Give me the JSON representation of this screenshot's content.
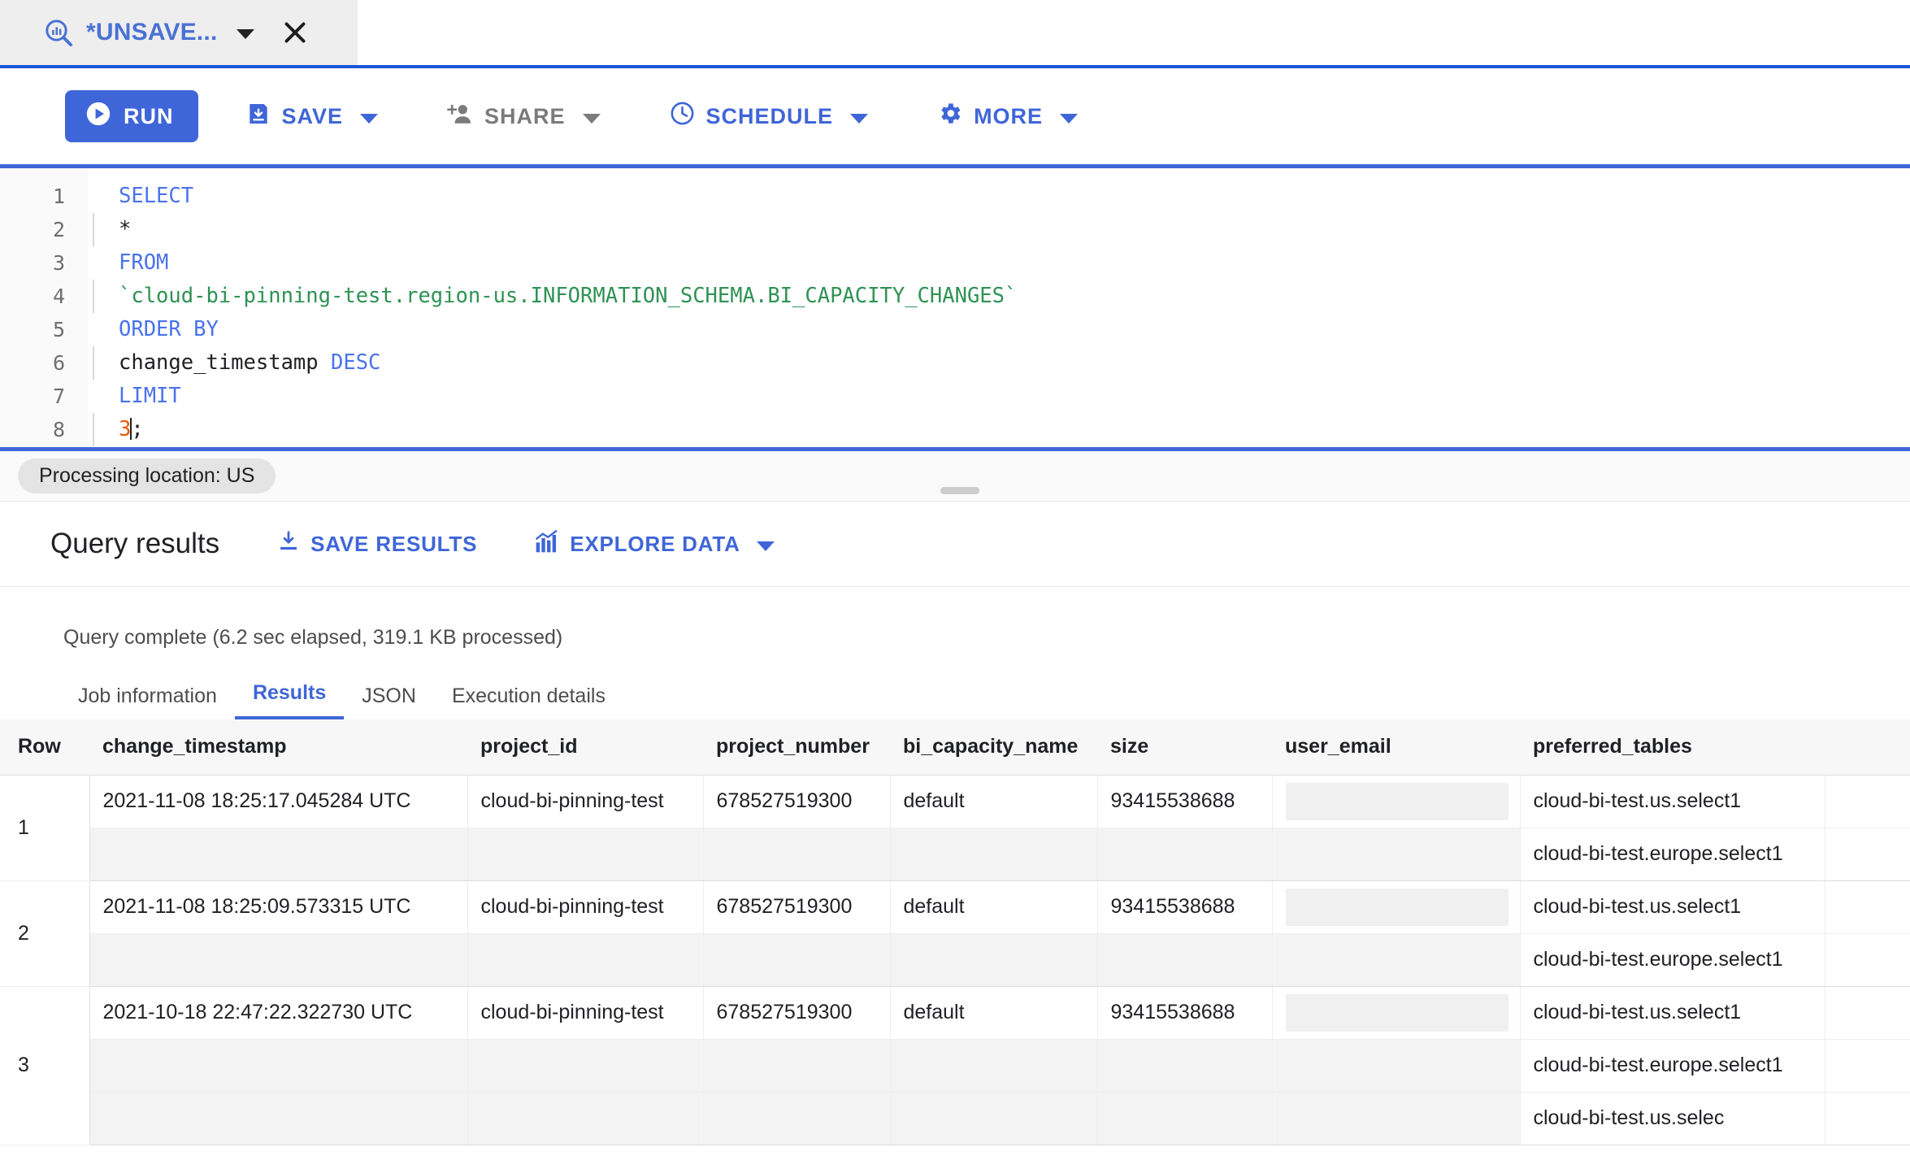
{
  "tab": {
    "label": "*UNSAVE...",
    "icon": "query-magnifier-icon",
    "caret": "chevron-down-icon",
    "close": "close-icon"
  },
  "toolbar": {
    "run_label": "RUN",
    "save_label": "SAVE",
    "share_label": "SHARE",
    "schedule_label": "SCHEDULE",
    "more_label": "MORE"
  },
  "editor": {
    "line_numbers": [
      "1",
      "2",
      "3",
      "4",
      "5",
      "6",
      "7",
      "8"
    ],
    "lines": [
      {
        "n": "1",
        "kw": "SELECT",
        "text": ""
      },
      {
        "n": "2",
        "indent": true,
        "text": "*"
      },
      {
        "n": "3",
        "kw": "FROM",
        "text": ""
      },
      {
        "n": "4",
        "indent": true,
        "str": "`cloud-bi-pinning-test.region-us.INFORMATION_SCHEMA.BI_CAPACITY_CHANGES`"
      },
      {
        "n": "5",
        "kw": "ORDER BY",
        "text": ""
      },
      {
        "n": "6",
        "indent": true,
        "text": "change_timestamp ",
        "kw2": "DESC"
      },
      {
        "n": "7",
        "kw": "LIMIT",
        "text": ""
      },
      {
        "n": "8",
        "indent": true,
        "num": "3",
        "tail": ";"
      }
    ],
    "l1_keyword": "SELECT",
    "l2_text": "*",
    "l3_keyword": "FROM",
    "l4_string": "`cloud-bi-pinning-test.region-us.INFORMATION_SCHEMA.BI_CAPACITY_CHANGES`",
    "l5_keyword": "ORDER BY",
    "l6_column": "change_timestamp",
    "l6_keyword": "DESC",
    "l7_keyword": "LIMIT",
    "l8_number": "3",
    "l8_semicolon": ";"
  },
  "location": {
    "chip": "Processing location: US"
  },
  "results": {
    "title": "Query results",
    "save_results_label": "SAVE RESULTS",
    "explore_data_label": "EXPLORE DATA",
    "status": "Query complete (6.2 sec elapsed, 319.1 KB processed)",
    "tabs": [
      {
        "label": "Job information",
        "active": false
      },
      {
        "label": "Results",
        "active": true
      },
      {
        "label": "JSON",
        "active": false
      },
      {
        "label": "Execution details",
        "active": false
      }
    ],
    "columns": [
      "Row",
      "change_timestamp",
      "project_id",
      "project_number",
      "bi_capacity_name",
      "size",
      "user_email",
      "preferred_tables"
    ],
    "rows": [
      {
        "row": "1",
        "change_timestamp": "2021-11-08 18:25:17.045284 UTC",
        "project_id": "cloud-bi-pinning-test",
        "project_number": "678527519300",
        "bi_capacity_name": "default",
        "size": "93415538688",
        "user_email": "",
        "preferred_tables": [
          "cloud-bi-test.us.select1",
          "cloud-bi-test.europe.select1"
        ]
      },
      {
        "row": "2",
        "change_timestamp": "2021-11-08 18:25:09.573315 UTC",
        "project_id": "cloud-bi-pinning-test",
        "project_number": "678527519300",
        "bi_capacity_name": "default",
        "size": "93415538688",
        "user_email": "",
        "preferred_tables": [
          "cloud-bi-test.us.select1",
          "cloud-bi-test.europe.select1"
        ]
      },
      {
        "row": "3",
        "change_timestamp": "2021-10-18 22:47:22.322730 UTC",
        "project_id": "cloud-bi-pinning-test",
        "project_number": "678527519300",
        "bi_capacity_name": "default",
        "size": "93415538688",
        "user_email": "",
        "preferred_tables": [
          "cloud-bi-test.us.select1",
          "cloud-bi-test.europe.select1",
          "cloud-bi-test.us.selec"
        ]
      }
    ]
  },
  "colors": {
    "accent": "#3f66d8",
    "tab_label": "#4a72d4",
    "keyword": "#4a72ec",
    "string": "#2f9254",
    "number": "#e8590c",
    "disabled": "#7b7b7b"
  }
}
